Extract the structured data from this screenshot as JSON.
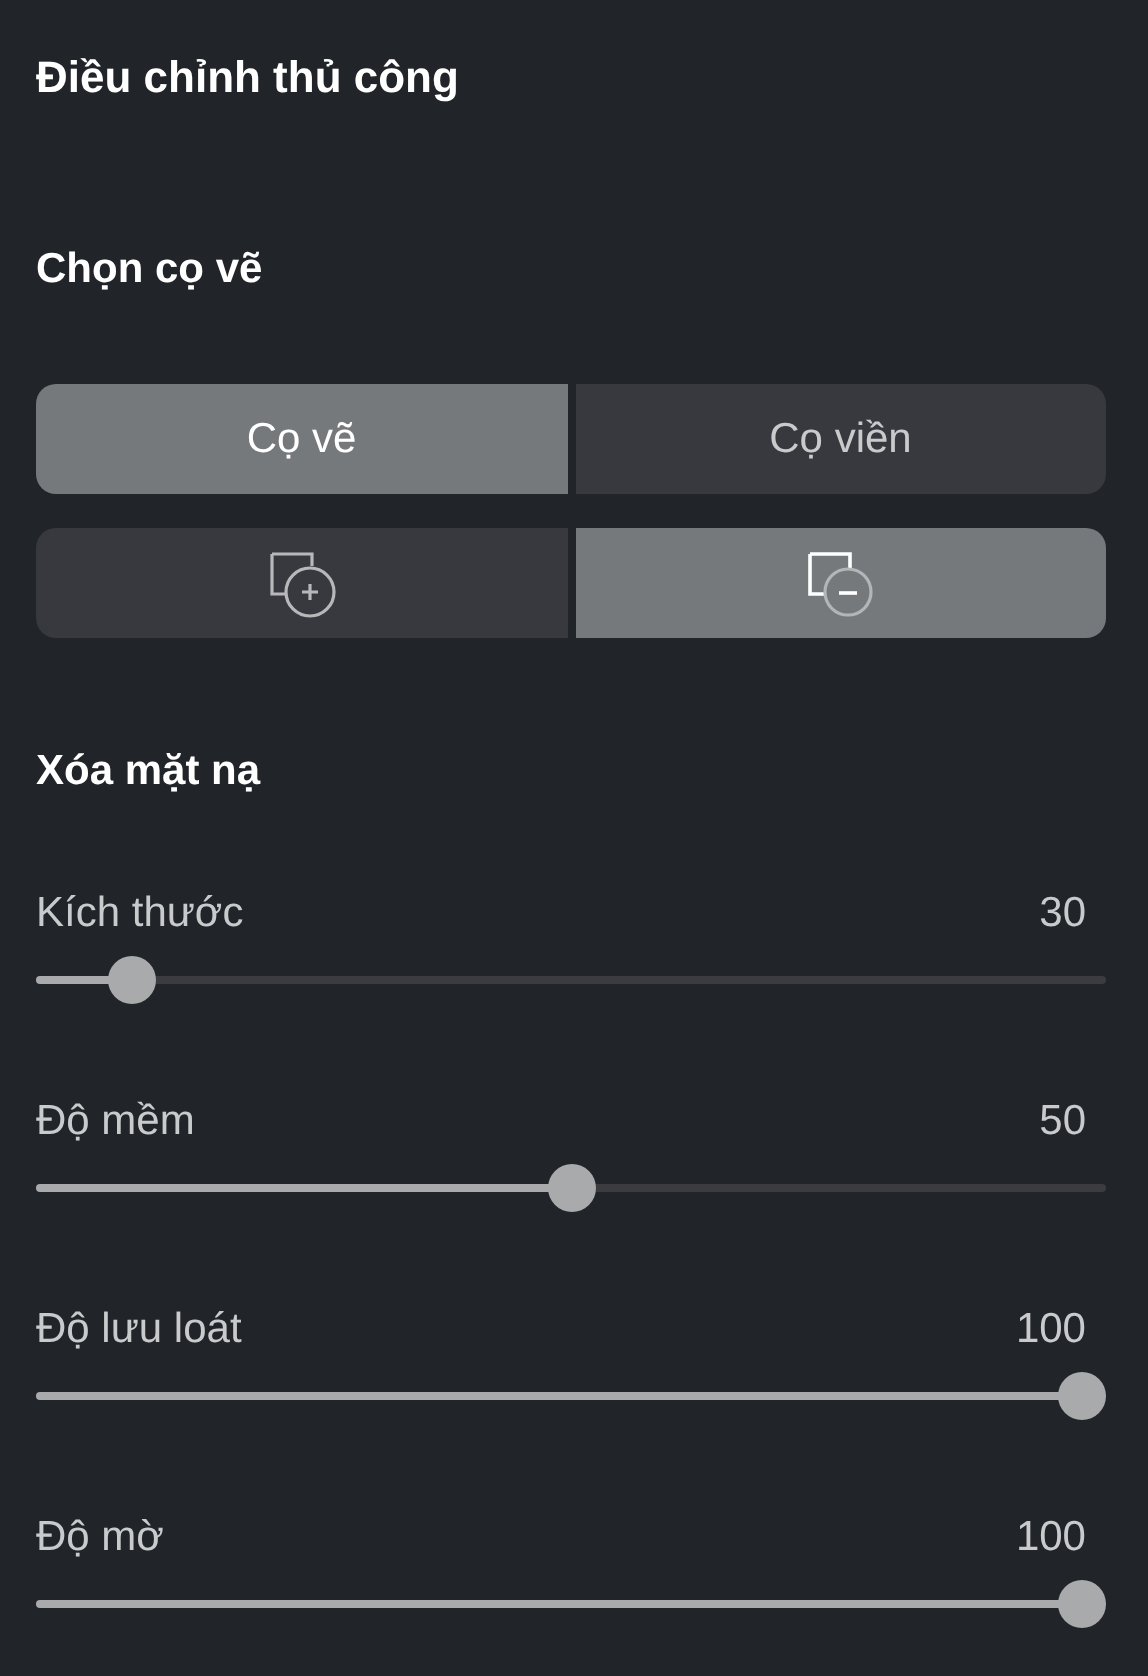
{
  "title": "Điều chỉnh thủ công",
  "brush_heading": "Chọn cọ vẽ",
  "brush_types": [
    {
      "label": "Cọ vẽ",
      "selected": true
    },
    {
      "label": "Cọ viền",
      "selected": false
    }
  ],
  "brush_modes": [
    {
      "kind": "add",
      "selected": false
    },
    {
      "kind": "subtract",
      "selected": true
    }
  ],
  "mode_heading": "Xóa mặt nạ",
  "sliders": [
    {
      "label": "Kích thước",
      "reading": "30",
      "level": 0.07
    },
    {
      "label": "Độ mềm",
      "reading": "50",
      "level": 0.5
    },
    {
      "label": "Độ lưu loát",
      "reading": "100",
      "level": 1
    },
    {
      "label": "Độ mờ",
      "reading": "100",
      "level": 1
    }
  ]
}
